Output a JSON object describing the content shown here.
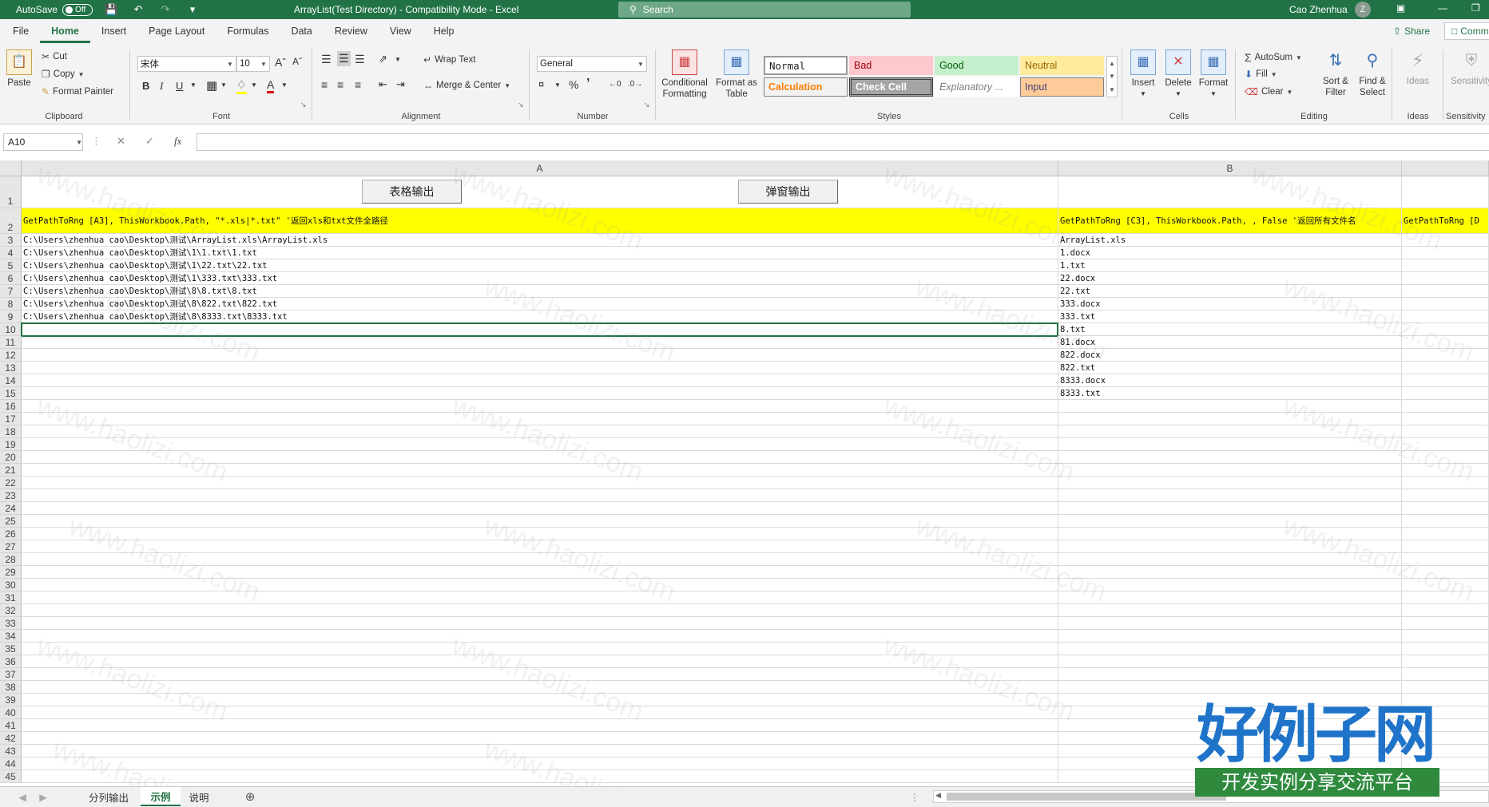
{
  "titlebar": {
    "autosave_label": "AutoSave",
    "autosave_state": "Off",
    "doc_title": "ArrayList(Test Directory)  -  Compatibility Mode  -  Excel",
    "search_placeholder": "Search",
    "user_name": "Cao Zhenhua",
    "user_initial": "Z"
  },
  "ribbon_tabs": [
    "File",
    "Home",
    "Insert",
    "Page Layout",
    "Formulas",
    "Data",
    "Review",
    "View",
    "Help"
  ],
  "active_tab": "Home",
  "share_label": "Share",
  "comments_label": "Comm",
  "clipboard": {
    "paste": "Paste",
    "cut": "Cut",
    "copy": "Copy",
    "format_painter": "Format Painter",
    "label": "Clipboard"
  },
  "font": {
    "name": "宋体",
    "size": "10",
    "label": "Font"
  },
  "alignment": {
    "wrap_text": "Wrap Text",
    "merge_center": "Merge & Center",
    "label": "Alignment"
  },
  "number": {
    "format": "General",
    "label": "Number"
  },
  "styles": {
    "conditional_formatting": "Conditional Formatting",
    "format_as_table": "Format as Table",
    "normal": "Normal",
    "bad": "Bad",
    "good": "Good",
    "neutral": "Neutral",
    "calculation": "Calculation",
    "check_cell": "Check Cell",
    "explanatory": "Explanatory ...",
    "input": "Input",
    "label": "Styles"
  },
  "cells_group": {
    "insert": "Insert",
    "delete": "Delete",
    "format": "Format",
    "label": "Cells"
  },
  "editing": {
    "autosum": "AutoSum",
    "fill": "Fill",
    "clear": "Clear",
    "sort_filter": "Sort & Filter",
    "find_select": "Find & Select",
    "label": "Editing"
  },
  "ideas": {
    "ideas": "Ideas",
    "label": "Ideas"
  },
  "sensitivity": {
    "label": "Sensitivity",
    "button": "Sensitivity"
  },
  "namebox": "A10",
  "formula": "",
  "columns": [
    {
      "name": "A"
    },
    {
      "name": "B"
    }
  ],
  "buttons": {
    "table_output": "表格输出",
    "popup_output": "弹窗输出"
  },
  "row2": {
    "a": "GetPathToRng [A3], ThisWorkbook.Path, \"*.xls|*.txt\" '返回xls和txt文件全路径",
    "b": "GetPathToRng [C3], ThisWorkbook.Path, , False '返回所有文件名",
    "c": "GetPathToRng [D"
  },
  "col_a": [
    "C:\\Users\\zhenhua cao\\Desktop\\测试\\ArrayList.xls\\ArrayList.xls",
    "C:\\Users\\zhenhua cao\\Desktop\\测试\\1\\1.txt\\1.txt",
    "C:\\Users\\zhenhua cao\\Desktop\\测试\\1\\22.txt\\22.txt",
    "C:\\Users\\zhenhua cao\\Desktop\\测试\\1\\333.txt\\333.txt",
    "C:\\Users\\zhenhua cao\\Desktop\\测试\\8\\8.txt\\8.txt",
    "C:\\Users\\zhenhua cao\\Desktop\\测试\\8\\822.txt\\822.txt",
    "C:\\Users\\zhenhua cao\\Desktop\\测试\\8\\8333.txt\\8333.txt"
  ],
  "col_b": [
    "ArrayList.xls",
    "1.docx",
    "1.txt",
    "22.docx",
    "22.txt",
    "333.docx",
    "333.txt",
    "8.txt",
    "81.docx",
    "822.docx",
    "822.txt",
    "8333.docx",
    "8333.txt"
  ],
  "row_count": 45,
  "sheet_tabs": [
    "分列输出",
    "示例",
    "说明"
  ],
  "active_sheet": "示例",
  "watermark": "www.haolizi.com",
  "logo": {
    "main": "好例子网",
    "sub": "开发实例分享交流平台"
  },
  "colors": {
    "excel_green": "#217346",
    "header_yellow": "#ffff00"
  }
}
